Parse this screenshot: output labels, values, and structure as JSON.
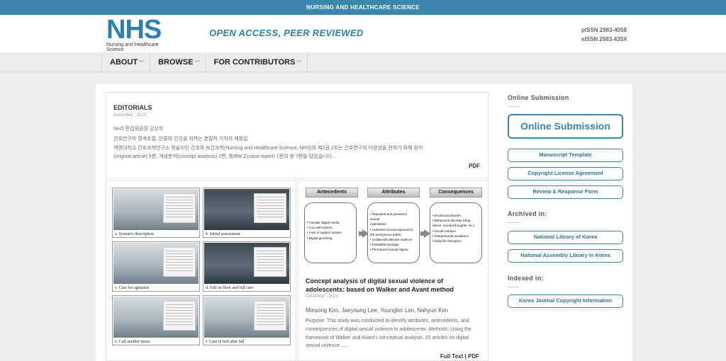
{
  "topbar": {
    "title": "NURSING AND HEALTHCARE SCIENCE"
  },
  "header": {
    "logo_text": "NHS",
    "logo_subtitle": "Nursing and Healthcare Science",
    "tagline": "OPEN ACCESS, PEER REVIEWED",
    "pissn": "pISSN 2983-4058",
    "eissn": "eISSN 2983-435X"
  },
  "nav": [
    {
      "label": "ABOUT"
    },
    {
      "label": "BROWSE"
    },
    {
      "label": "FOR CONTRIBUTORS"
    }
  ],
  "editorial": {
    "heading": "EDITORIALS",
    "date": "December , 2023",
    "author": "NHS 편집위원장 김상희",
    "line1": "간호연구의 경계조절, 인류의 건강을 위하는 본질적 가치의 재정립",
    "line2": "계명대학교 간호과학연구소 학술지인 간호와 보건과학(Nursing and Healthcare Science, NHS)의 제2권 2호는 간호연구의 다양성을 전하기 위해 원저",
    "line3": "(original article) 5편, 개념분석(concept analysis) 1편, 증례보고(case report) 1편의 총 7편을 담았습니다...",
    "pdf": "PDF"
  },
  "figure": {
    "captions": [
      "a. Scenario description",
      "b. Initial assessment",
      "c. Care for agitation",
      "d. Fall on floor and fall care",
      "e. Call another nurse",
      "f. Care in bed after fall"
    ]
  },
  "diagram": {
    "antecedents_label": "Antecedents",
    "attributes_label": "Attributes",
    "consequences_label": "Consequences",
    "antecedents": [
      "• Familiar digital media",
      "• Low self-esteem",
      "• Lack of support system",
      "• Digital grooming"
    ],
    "attributes": [
      "• Repeated and persistent sexual",
      "  exploitation",
      "• Unlimited sexual exposure to",
      "  the anonymous public",
      "• Unilateral/collective violence",
      "• Inevitable bondage",
      "• Permanent sexual stigma"
    ],
    "consequences": [
      "• Emotional disorder",
      "• Behavioral disorder (drug",
      "  abuse, suicidal thoughts, etc.)",
      "• Social isolation",
      "• Interpersonal avoidance",
      "• Daily life disruption"
    ]
  },
  "article": {
    "title": "Concept analysis of digital sexual violence of adolescents: based on Walker and Avant method",
    "date": "December , 2023",
    "authors": "Minsong Kim, Jaeyoung Lee, Younglim Lim, Nahyun Kim",
    "abstract": "Purpose: This study was conducted to identify attributes, antecedents, and consequences of digital sexual violence in adolescents. Methods: Using the framework of Walker and Avant's conceptual analysis, 22 articles on digital sexual violence ......",
    "full_text": "Full Text",
    "separator": "|",
    "pdf": "PDF"
  },
  "sidebar": {
    "online_submission_heading": "Online Submission",
    "online_submission_button": "Online Submission",
    "manuscript_template": "Manuscript Template",
    "copyright_agreement": "Copyright License Agreement",
    "review_form": "Review & Response Form",
    "archived_heading": "Archived in:",
    "national_library": "National Library of Korea",
    "assembly_library": "National Assembly Library in Korea",
    "indexed_heading": "Indexed in:",
    "kci": "Korea Journal Copyright Information"
  },
  "colors": {
    "brand": "#3a86ad",
    "brand_text": "#2f7fb3"
  }
}
